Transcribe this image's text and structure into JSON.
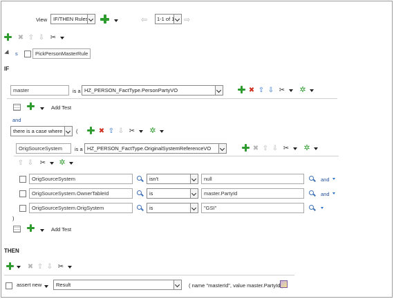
{
  "view_bar": {
    "view_label": "View",
    "view_select": "IF/THEN Rules",
    "pager": "1-1 of 1"
  },
  "rule": {
    "name": "PickPersonMasterRule",
    "expand_glyph": "s"
  },
  "if_label": "IF",
  "then_label": "THEN",
  "pattern1": {
    "var_name": "master",
    "is_a": "is a",
    "fact_type": "HZ_PERSON_FactType.PersonPartyVO",
    "add_test": "Add Test"
  },
  "and_label": "and",
  "case_where": {
    "select": "there is a case where",
    "paren": "("
  },
  "pattern2": {
    "var_name": "OrigSourceSystem",
    "is_a": "is a",
    "fact_type": "HZ_PERSON_FactType.OriginalSystemReferenceVO",
    "add_test": "Add Test",
    "close_paren": ")"
  },
  "tests": [
    {
      "left": "OrigSourceSystem",
      "op": "isn't",
      "right": "null",
      "conj": "and"
    },
    {
      "left": "OrigSourceSystem.OwnerTableId",
      "op": "is",
      "right": "master.PartyId",
      "conj": "and"
    },
    {
      "left": "OrigSourceSystem.OrigSystem",
      "op": "is",
      "right": "\"GSI\"",
      "conj": ""
    }
  ],
  "action": {
    "verb": "assert new",
    "target": "Result",
    "args": "( name \"masterId\", value master.PartyId )"
  }
}
